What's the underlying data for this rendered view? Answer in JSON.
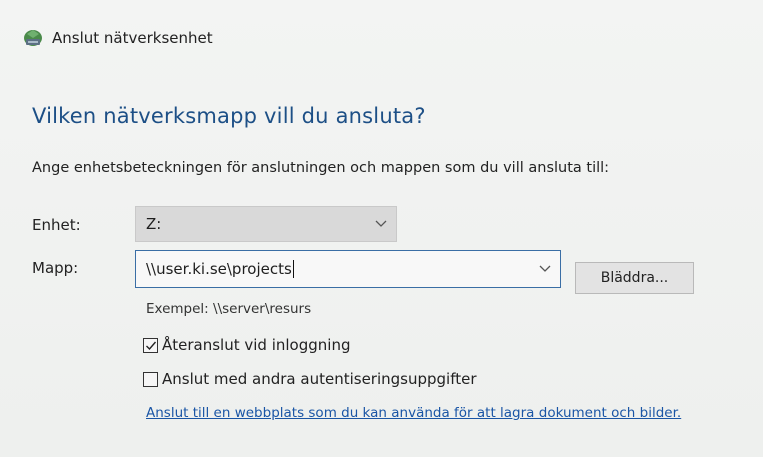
{
  "window": {
    "title": "Anslut nätverksenhet",
    "icon": "network-drive-icon"
  },
  "heading": "Vilken nätverksmapp vill du ansluta?",
  "instruction": "Ange enhetsbeteckningen för anslutningen och mappen som du vill ansluta till:",
  "drive": {
    "label": "Enhet:",
    "value": "Z:"
  },
  "folder": {
    "label": "Mapp:",
    "value": "\\\\user.ki.se\\projects"
  },
  "browse_label": "Bläddra...",
  "example": "Exempel: \\\\server\\resurs",
  "reconnect": {
    "label": "Återanslut vid inloggning",
    "checked": true
  },
  "other_credentials": {
    "label": "Anslut med andra autentiseringsuppgifter",
    "checked": false
  },
  "link": "Anslut till en webbplats som du kan använda för att lagra dokument och bilder.",
  "colors": {
    "heading": "#1d4f86",
    "link": "#1a55a5",
    "background": "#f1f2f1"
  }
}
